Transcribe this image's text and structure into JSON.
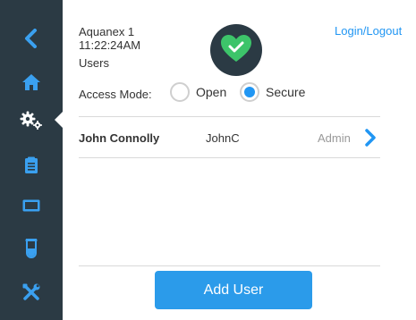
{
  "header": {
    "device_name": "Aquanex 1",
    "time": "11:22:24AM",
    "section": "Users",
    "login_label": "Login/Logout",
    "status_icon": "check-heart-icon"
  },
  "sidebar": {
    "items": [
      {
        "icon": "back-chevron-icon"
      },
      {
        "icon": "home-icon"
      },
      {
        "icon": "settings-gears-icon",
        "active": true
      },
      {
        "icon": "clipboard-icon"
      },
      {
        "icon": "screen-icon"
      },
      {
        "icon": "test-tube-icon"
      },
      {
        "icon": "tools-icon"
      }
    ]
  },
  "access_mode": {
    "label": "Access Mode:",
    "options": [
      "Open",
      "Secure"
    ],
    "selected": "Secure"
  },
  "users": [
    {
      "full_name": "John Connolly",
      "username": "JohnC",
      "role": "Admin"
    }
  ],
  "actions": {
    "add_user_label": "Add User"
  },
  "colors": {
    "sidebar_bg": "#2b3a44",
    "accent_blue": "#2196f3",
    "button_blue": "#2b9bea",
    "status_green": "#3dc46a"
  }
}
